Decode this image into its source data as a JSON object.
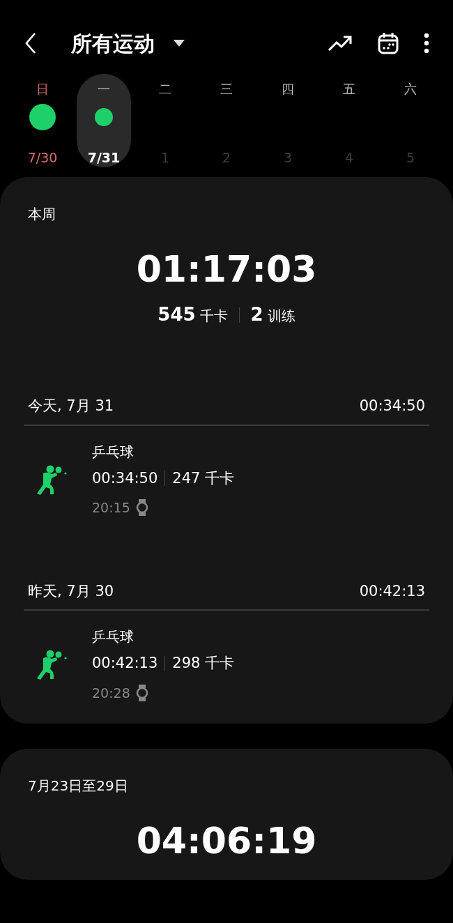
{
  "header": {
    "title": "所有运动"
  },
  "week": [
    {
      "weekday": "日",
      "date": "7/30",
      "holiday": true,
      "workout": true,
      "future": false,
      "selected": false
    },
    {
      "weekday": "一",
      "date": "7/31",
      "holiday": false,
      "workout": true,
      "future": false,
      "selected": true
    },
    {
      "weekday": "二",
      "date": "1",
      "holiday": false,
      "workout": false,
      "future": true,
      "selected": false
    },
    {
      "weekday": "三",
      "date": "2",
      "holiday": false,
      "workout": false,
      "future": true,
      "selected": false
    },
    {
      "weekday": "四",
      "date": "3",
      "holiday": false,
      "workout": false,
      "future": true,
      "selected": false
    },
    {
      "weekday": "五",
      "date": "4",
      "holiday": false,
      "workout": false,
      "future": true,
      "selected": false
    },
    {
      "weekday": "六",
      "date": "5",
      "holiday": false,
      "workout": false,
      "future": true,
      "selected": false
    }
  ],
  "cards": [
    {
      "period": "本周",
      "total": "01:17:03",
      "calories": "545",
      "calories_unit": "千卡",
      "sessions": "2",
      "sessions_unit": "训练",
      "days": [
        {
          "label": "今天, 7月 31",
          "total": "00:34:50",
          "activities": [
            {
              "name": "乒乓球",
              "duration": "00:34:50",
              "calories": "247 千卡",
              "start": "20:15"
            }
          ]
        },
        {
          "label": "昨天, 7月 30",
          "total": "00:42:13",
          "activities": [
            {
              "name": "乒乓球",
              "duration": "00:42:13",
              "calories": "298 千卡",
              "start": "20:28"
            }
          ]
        }
      ]
    },
    {
      "period": "7月23日至29日",
      "total": "04:06:19"
    }
  ]
}
